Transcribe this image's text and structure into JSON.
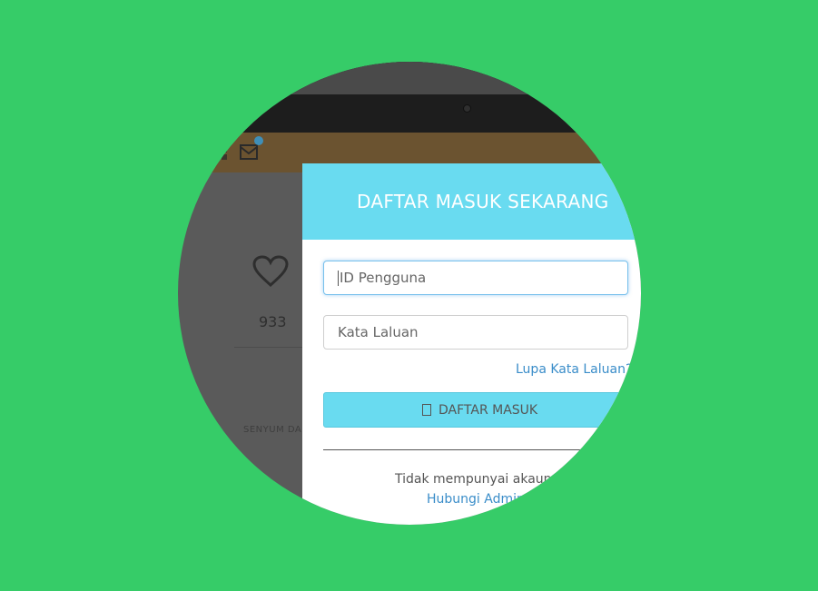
{
  "login": {
    "title": "DAFTAR MASUK SEKARANG",
    "username_placeholder": "ID Pengguna",
    "password_placeholder": "Kata Laluan",
    "forgot_link": "Lupa Kata Laluan?",
    "login_button": "DAFTAR MASUK",
    "no_account_text": "Tidak mempunyai akaun",
    "contact_admin_link": "Hubungi Admin"
  },
  "background": {
    "like_count": "933",
    "blurred_text": "SENYUM DAN TAK"
  },
  "colors": {
    "page_bg": "#36cc68",
    "accent": "#69dbf0",
    "link": "#3a8dc9",
    "dim_overlay": "#5a5a5a"
  },
  "icons": {
    "heart": "heart-icon",
    "mail": "mail-icon",
    "grid": "grid-icon",
    "login": "sign-in-icon"
  }
}
